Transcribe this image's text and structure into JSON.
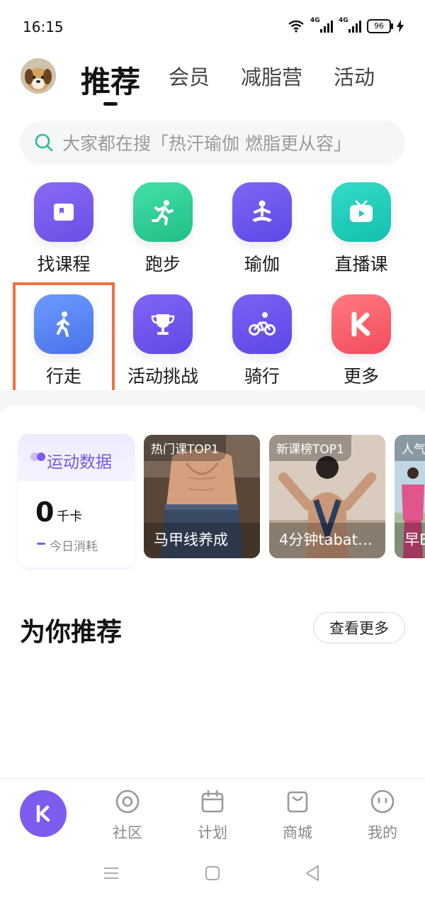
{
  "status_bar": {
    "time": "16:15",
    "net1": "4G",
    "net2": "4G",
    "battery": "96"
  },
  "header": {
    "tabs": [
      {
        "label": "推荐",
        "active": true
      },
      {
        "label": "会员"
      },
      {
        "label": "减脂营"
      },
      {
        "label": "活动"
      }
    ]
  },
  "search": {
    "placeholder": "大家都在搜「热汗瑜伽 燃脂更从容」"
  },
  "grid": [
    {
      "label": "找课程",
      "icon": "course-card-icon",
      "color": "#7c5cf2"
    },
    {
      "label": "跑步",
      "icon": "running-icon",
      "color": "#2fd49a"
    },
    {
      "label": "瑜伽",
      "icon": "yoga-icon",
      "color": "#6f5af0"
    },
    {
      "label": "直播课",
      "icon": "tv-live-icon",
      "color": "#20cdbd"
    },
    {
      "label": "行走",
      "icon": "walking-icon",
      "color": "#5b86f5"
    },
    {
      "label": "活动挑战",
      "icon": "trophy-icon",
      "color": "#7354ef"
    },
    {
      "label": "骑行",
      "icon": "cycling-icon",
      "color": "#6d55ef"
    },
    {
      "label": "更多",
      "icon": "keep-logo-icon",
      "color": "#ff5f6e"
    }
  ],
  "stats": {
    "title": "运动数据",
    "value": "0",
    "unit": "千卡",
    "sub": "今日消耗"
  },
  "courses": [
    {
      "tag": "热门课TOP1",
      "title": "马甲线养成"
    },
    {
      "tag": "新课榜TOP1",
      "title": "4分钟tabat…"
    },
    {
      "tag": "人气",
      "title": "早E"
    }
  ],
  "recommend": {
    "title": "为你推荐",
    "more": "查看更多"
  },
  "bottom_nav": [
    {
      "label": "社区"
    },
    {
      "label": "计划"
    },
    {
      "label": "商城"
    },
    {
      "label": "我的"
    }
  ],
  "colors": {
    "accent": "#7e5bef",
    "highlight": "#f07240"
  }
}
